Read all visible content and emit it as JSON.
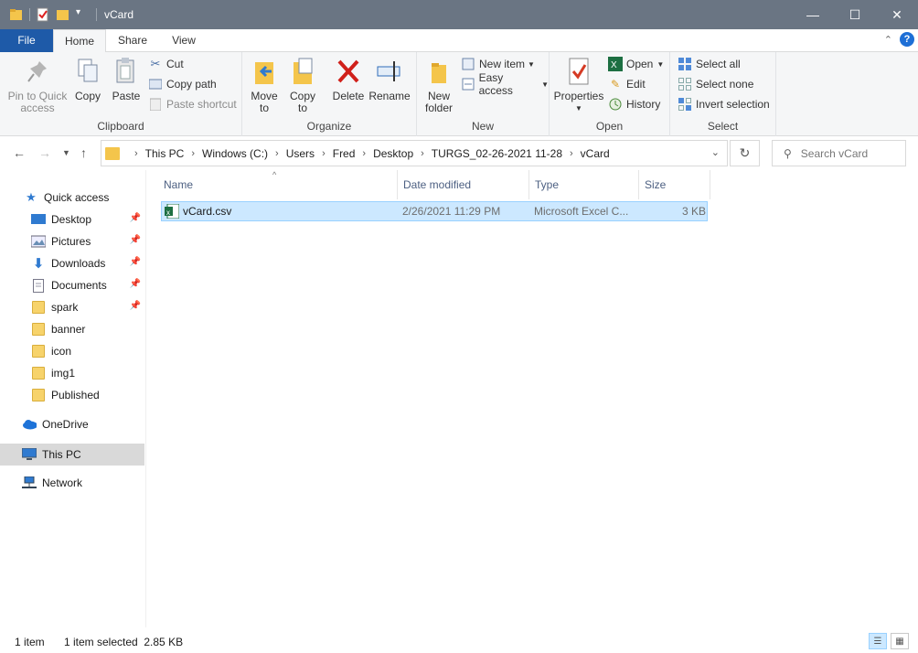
{
  "window": {
    "title": "vCard"
  },
  "window_buttons": {
    "minimize": "—",
    "maximize": "☐",
    "close": "✕"
  },
  "ribbon_tabs": {
    "file": "File",
    "home": "Home",
    "share": "Share",
    "view": "View"
  },
  "ribbon": {
    "clipboard": {
      "label": "Clipboard",
      "pin": "Pin to Quick access",
      "pin_line1": "Pin to Quick",
      "pin_line2": "access",
      "copy": "Copy",
      "paste": "Paste",
      "cut": "Cut",
      "copy_path": "Copy path",
      "paste_shortcut": "Paste shortcut"
    },
    "organize": {
      "label": "Organize",
      "move_to_line1": "Move",
      "move_to_line2": "to",
      "copy_to_line1": "Copy",
      "copy_to_line2": "to",
      "delete": "Delete",
      "rename": "Rename"
    },
    "new": {
      "label": "New",
      "new_folder_line1": "New",
      "new_folder_line2": "folder",
      "new_item": "New item",
      "easy_access": "Easy access"
    },
    "open": {
      "label": "Open",
      "properties": "Properties",
      "open": "Open",
      "edit": "Edit",
      "history": "History"
    },
    "select": {
      "label": "Select",
      "select_all": "Select all",
      "select_none": "Select none",
      "invert": "Invert selection"
    }
  },
  "address": {
    "crumbs": [
      "This PC",
      "Windows (C:)",
      "Users",
      "Fred",
      "Desktop",
      "TURGS_02-26-2021 11-28",
      "vCard"
    ]
  },
  "search": {
    "placeholder": "Search vCard"
  },
  "nav": {
    "quick_access": "Quick access",
    "items": [
      {
        "label": "Desktop",
        "pinned": true
      },
      {
        "label": "Pictures",
        "pinned": true
      },
      {
        "label": "Downloads",
        "pinned": true
      },
      {
        "label": "Documents",
        "pinned": true
      },
      {
        "label": "spark",
        "pinned": true
      },
      {
        "label": "banner",
        "pinned": false
      },
      {
        "label": "icon",
        "pinned": false
      },
      {
        "label": "img1",
        "pinned": false
      },
      {
        "label": "Published",
        "pinned": false
      }
    ],
    "onedrive": "OneDrive",
    "this_pc": "This PC",
    "network": "Network"
  },
  "columns": {
    "name": "Name",
    "date": "Date modified",
    "type": "Type",
    "size": "Size"
  },
  "files": [
    {
      "name": "vCard.csv",
      "date": "2/26/2021 11:29 PM",
      "type": "Microsoft Excel C...",
      "size": "3 KB"
    }
  ],
  "status": {
    "count": "1 item",
    "selection": "1 item selected  2.85 KB"
  },
  "colors": {
    "title_bar": "#6a7583",
    "file_tab": "#1e5aa8",
    "selection": "#cce8ff",
    "folder": "#f7d36b"
  }
}
